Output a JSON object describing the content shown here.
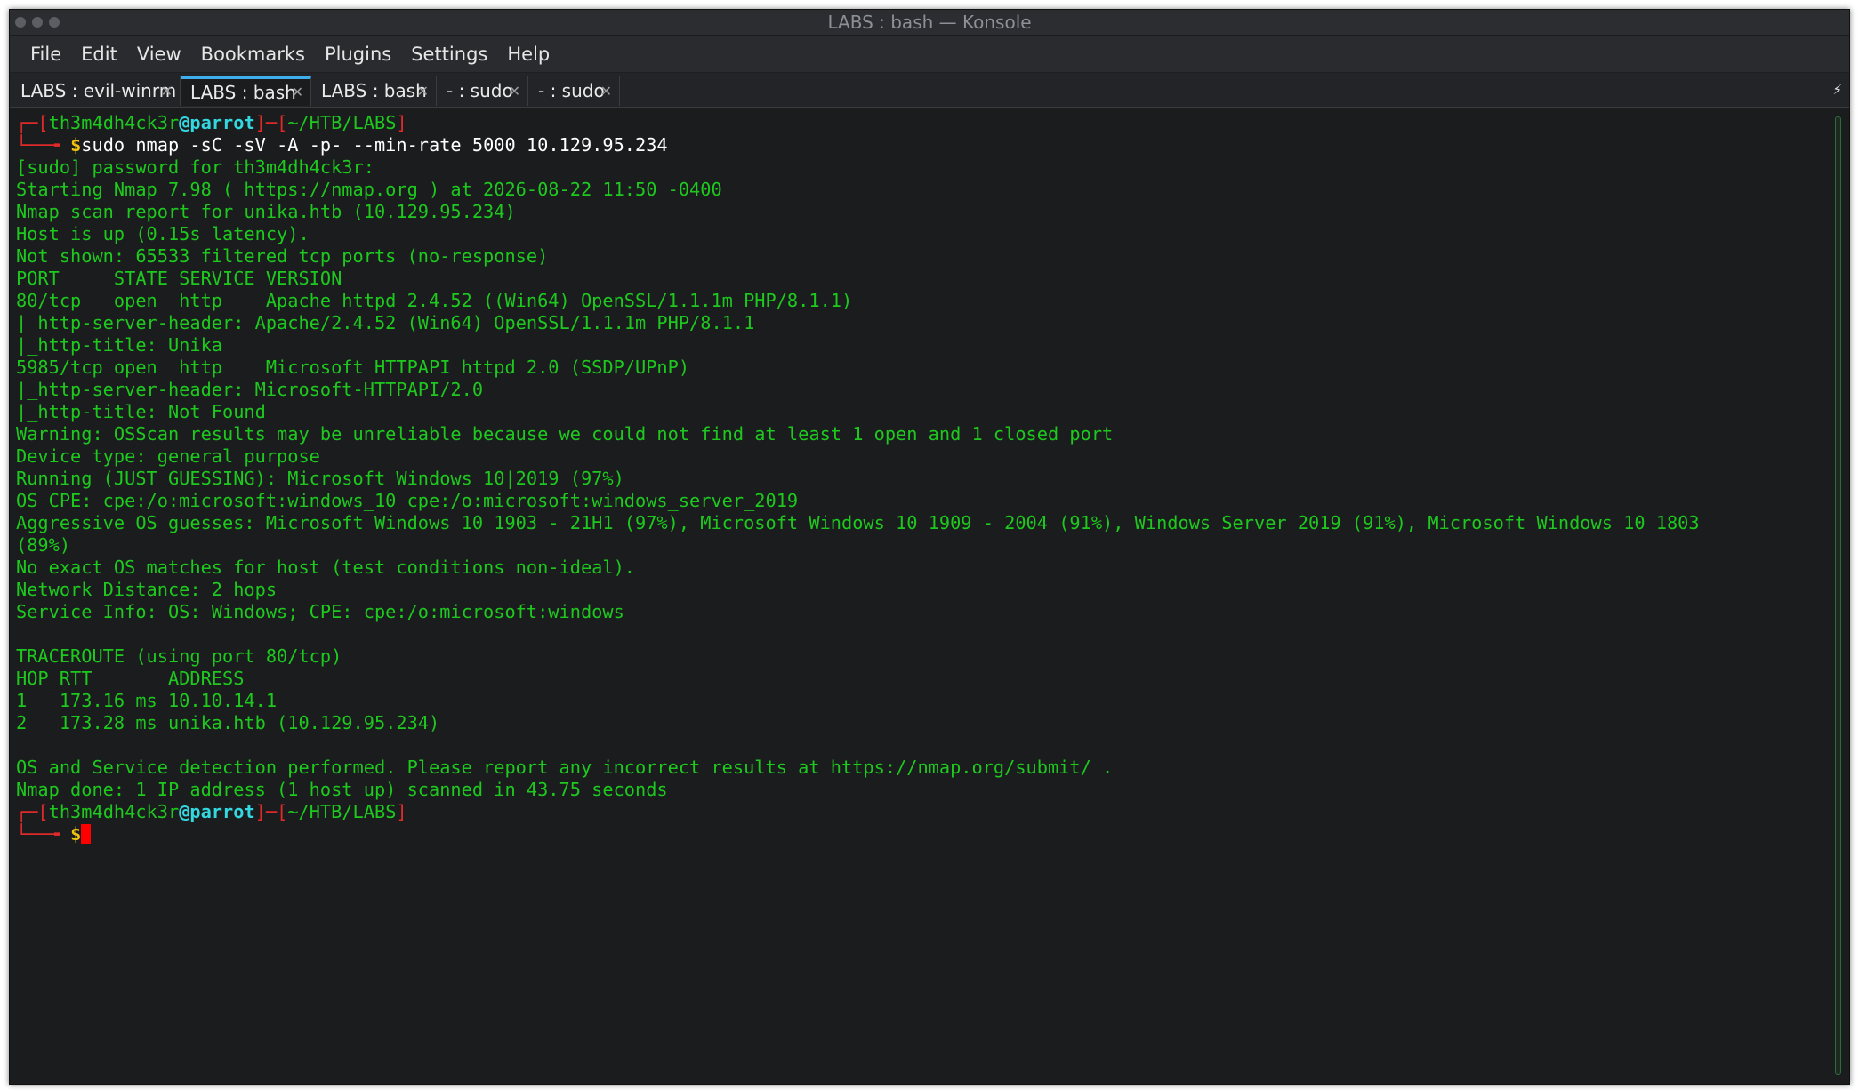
{
  "window": {
    "title": "LABS : bash — Konsole"
  },
  "menu": [
    "File",
    "Edit",
    "View",
    "Bookmarks",
    "Plugins",
    "Settings",
    "Help"
  ],
  "tabs": [
    {
      "label": "LABS : evil-winrm",
      "active": false
    },
    {
      "label": "LABS : bash",
      "active": true
    },
    {
      "label": "LABS : bash",
      "active": false
    },
    {
      "label": "- : sudo",
      "active": false
    },
    {
      "label": "- : sudo",
      "active": false
    }
  ],
  "prompt": {
    "user": "th3m4dh4ck3r",
    "at": "@",
    "host": "parrot",
    "path": "~/HTB/LABS",
    "symbol": "$"
  },
  "command": "sudo nmap -sC -sV -A -p- --min-rate 5000 10.129.95.234",
  "output": [
    "[sudo] password for th3m4dh4ck3r:",
    "Starting Nmap 7.98 ( https://nmap.org ) at 2026-08-22 11:50 -0400",
    "Nmap scan report for unika.htb (10.129.95.234)",
    "Host is up (0.15s latency).",
    "Not shown: 65533 filtered tcp ports (no-response)",
    "PORT     STATE SERVICE VERSION",
    "80/tcp   open  http    Apache httpd 2.4.52 ((Win64) OpenSSL/1.1.1m PHP/8.1.1)",
    "|_http-server-header: Apache/2.4.52 (Win64) OpenSSL/1.1.1m PHP/8.1.1",
    "|_http-title: Unika",
    "5985/tcp open  http    Microsoft HTTPAPI httpd 2.0 (SSDP/UPnP)",
    "|_http-server-header: Microsoft-HTTPAPI/2.0",
    "|_http-title: Not Found",
    "Warning: OSScan results may be unreliable because we could not find at least 1 open and 1 closed port",
    "Device type: general purpose",
    "Running (JUST GUESSING): Microsoft Windows 10|2019 (97%)",
    "OS CPE: cpe:/o:microsoft:windows_10 cpe:/o:microsoft:windows_server_2019",
    "Aggressive OS guesses: Microsoft Windows 10 1903 - 21H1 (97%), Microsoft Windows 10 1909 - 2004 (91%), Windows Server 2019 (91%), Microsoft Windows 10 1803",
    "(89%)",
    "No exact OS matches for host (test conditions non-ideal).",
    "Network Distance: 2 hops",
    "Service Info: OS: Windows; CPE: cpe:/o:microsoft:windows",
    "",
    "TRACEROUTE (using port 80/tcp)",
    "HOP RTT       ADDRESS",
    "1   173.16 ms 10.10.14.1",
    "2   173.28 ms unika.htb (10.129.95.234)",
    "",
    "OS and Service detection performed. Please report any incorrect results at https://nmap.org/submit/ .",
    "Nmap done: 1 IP address (1 host up) scanned in 43.75 seconds"
  ],
  "colors": {
    "terminal_bg": "#1b1c1e",
    "output_green": "#1ec91e",
    "prompt_red": "#e02a2a",
    "host_cyan": "#33d7e0",
    "dollar_yellow": "#f1c40f",
    "cursor_red": "#ff0000",
    "active_tab_accent": "#3daee9"
  }
}
